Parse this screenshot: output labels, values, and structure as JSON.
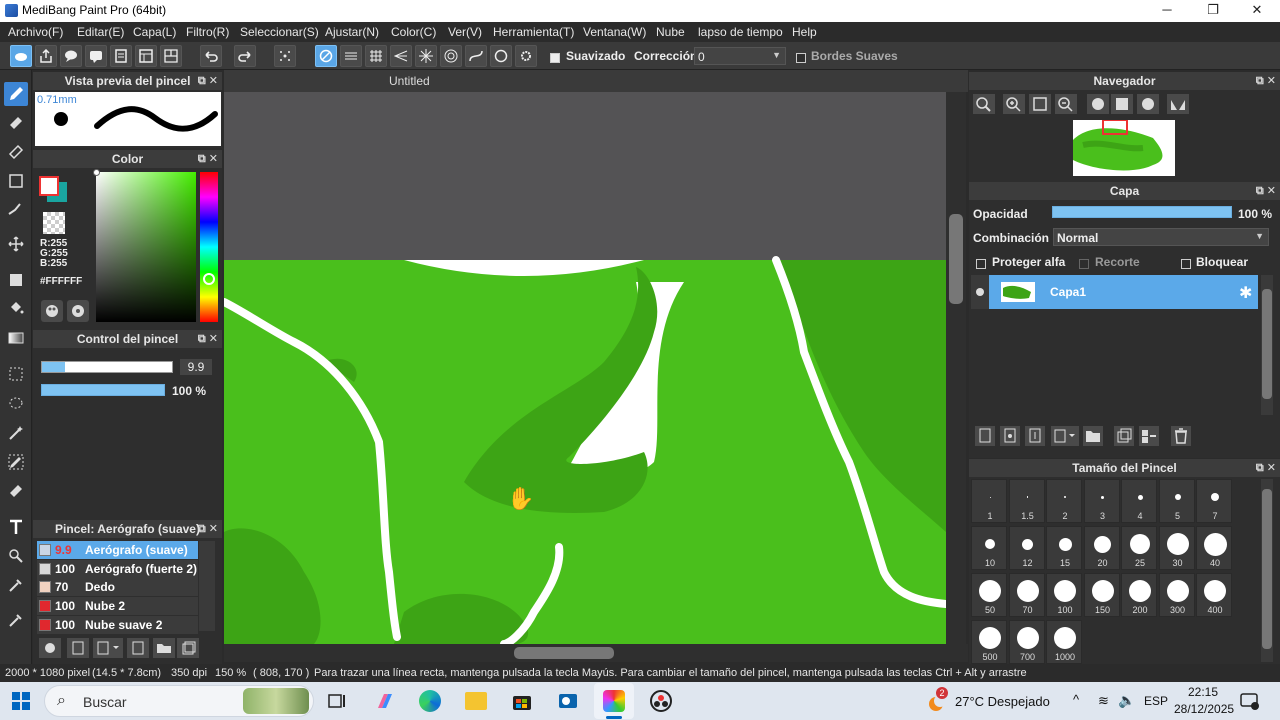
{
  "window": {
    "title": "MediBang Paint Pro (64bit)"
  },
  "menu": [
    "Archivo(F)",
    "Editar(E)",
    "Capa(L)",
    "Filtro(R)",
    "Seleccionar(S)",
    "Ajustar(N)",
    "Color(C)",
    "Ver(V)",
    "Herramienta(T)",
    "Ventana(W)",
    "Nube",
    "lapso de tiempo",
    "Help"
  ],
  "toolbar": {
    "smooth_label": "Suavizado",
    "correction_label": "Corrección",
    "correction_value": "0",
    "soft_edges_label": "Bordes Suaves"
  },
  "brush_preview": {
    "title": "Vista previa del pincel",
    "size": "0.71mm"
  },
  "color": {
    "title": "Color",
    "r": "R:255",
    "g": "G:255",
    "b": "B:255",
    "hex": "#FFFFFF",
    "primary": "#ffffff",
    "secondary": "#1aa5a0"
  },
  "brush_control": {
    "title": "Control del pincel",
    "size_value": "9.9",
    "opacity_value": "100 %",
    "size_fraction": 0.18,
    "opacity_fraction": 1.0
  },
  "brush_list": {
    "title": "Pincel: Aerógrafo (suave)",
    "items": [
      {
        "value": "9.9",
        "name": "Aerógrafo (suave)",
        "color": "#c9d6e6",
        "selected": true
      },
      {
        "value": "100",
        "name": "Aerógrafo (fuerte 2)",
        "color": "#d9d9d9",
        "selected": false
      },
      {
        "value": "70",
        "name": "Dedo",
        "color": "#f1d2c0",
        "selected": false
      },
      {
        "value": "100",
        "name": "Nube 2",
        "color": "#e0282e",
        "selected": false
      },
      {
        "value": "100",
        "name": "Nube suave 2",
        "color": "#e0282e",
        "selected": false
      }
    ]
  },
  "canvas": {
    "tab_title": "Untitled"
  },
  "navigator": {
    "title": "Navegador"
  },
  "layers": {
    "title": "Capa",
    "opacity_label": "Opacidad",
    "opacity_value": "100 %",
    "opacity_fraction": 1.0,
    "blend_label": "Combinación",
    "blend_value": "Normal",
    "protect_alpha": "Proteger alfa",
    "clip": "Recorte",
    "lock": "Bloquear",
    "layer_name": "Capa1"
  },
  "brush_size": {
    "title": "Tamaño del Pincel",
    "sizes": [
      "1",
      "1.5",
      "2",
      "3",
      "4",
      "5",
      "7",
      "10",
      "12",
      "15",
      "20",
      "25",
      "30",
      "40",
      "50",
      "70",
      "100",
      "150",
      "200",
      "300",
      "400",
      "500",
      "700",
      "1000"
    ]
  },
  "status": {
    "size": "2000 * 1080 pixel",
    "cm": "(14.5 * 7.8cm)",
    "dpi": "350 dpi",
    "zoom": "150 %",
    "coords": "( 808, 170 )",
    "hint": "Para trazar una línea recta, mantenga pulsada la tecla Mayús. Para cambiar el tamaño del pincel, mantenga pulsada las teclas Ctrl + Alt y arrastre"
  },
  "taskbar": {
    "search": "Buscar",
    "weather": "27°C  Despejado",
    "lang": "ESP",
    "time": "22:15",
    "date": "28/12/2025",
    "weather_badge": "2"
  }
}
